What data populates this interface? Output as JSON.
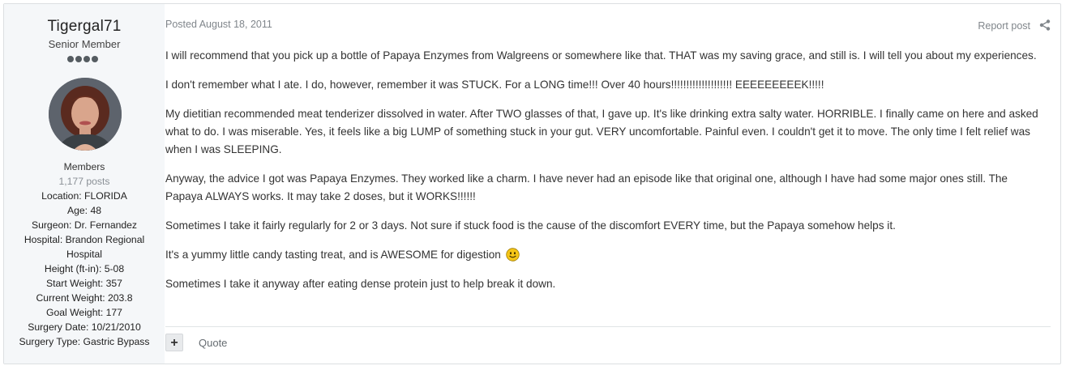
{
  "author": {
    "username": "Tigergal71",
    "rank": "Senior Member",
    "rank_pips": 4,
    "group": "Members",
    "posts": "1,177 posts",
    "fields": [
      "Location: FLORIDA",
      "Age: 48",
      "Surgeon: Dr. Fernandez",
      "Hospital: Brandon Regional Hospital",
      "Height (ft-in): 5-08",
      "Start Weight: 357",
      "Current Weight: 203.8",
      "Goal Weight: 177",
      "Surgery Date: 10/21/2010",
      "Surgery Type: Gastric Bypass"
    ]
  },
  "post": {
    "posted": "Posted August 18, 2011",
    "report_label": "Report post",
    "paragraphs": [
      "I will recommend that you pick up a bottle of Papaya Enzymes from Walgreens or somewhere like that. THAT was my saving grace, and still is. I will tell you about my experiences.",
      "I don't remember what I ate. I do, however, remember it was STUCK. For a LONG time!!! Over 40 hours!!!!!!!!!!!!!!!!!!!! EEEEEEEEEK!!!!!",
      "My dietitian recommended meat tenderizer dissolved in water. After TWO glasses of that, I gave up. It's like drinking extra salty water. HORRIBLE. I finally came on here and asked what to do. I was miserable. Yes, it feels like a big LUMP of something stuck in your gut. VERY uncomfortable. Painful even. I couldn't get it to move. The only time I felt relief was when I was SLEEPING.",
      "Anyway, the advice I got was Papaya Enzymes. They worked like a charm. I have never had an episode like that original one, although I have had some major ones still. The Papaya ALWAYS works. It may take 2 doses, but it WORKS!!!!!!",
      "Sometimes I take it fairly regularly for 2 or 3 days. Not sure if stuck food is the cause of the discomfort EVERY time, but the Papaya somehow helps it.",
      "It's a yummy little candy tasting treat, and is AWESOME for digestion",
      "Sometimes I take it anyway after eating dense protein just to help break it down."
    ],
    "plus_label": "+",
    "quote_label": "Quote"
  },
  "icons": {
    "share": "share-icon",
    "smiley": "smiley-icon"
  },
  "colors": {
    "sidebar_bg": "#f5f7f9",
    "muted_text": "#80868b",
    "smiley_yellow": "#f5c518"
  }
}
